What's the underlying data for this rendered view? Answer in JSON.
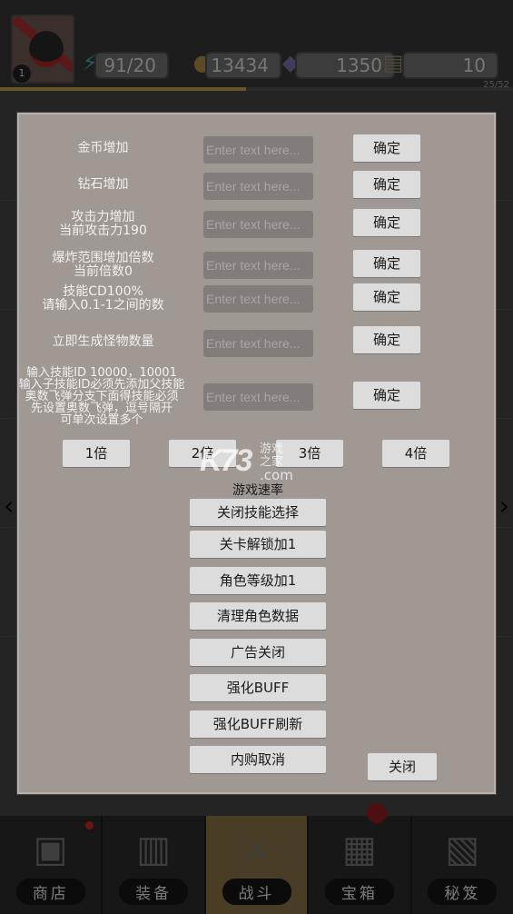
{
  "hud": {
    "player_level": "1",
    "energy": "91/20",
    "gold": "13434",
    "diamonds": "1350",
    "scrolls": "10",
    "stage_progress_label": "25/52",
    "stage_progress_fraction": 0.48,
    "icons": {
      "energy": "lightning-icon",
      "gold": "coin-icon",
      "diamonds": "diamond-icon",
      "scrolls": "scroll-icon"
    }
  },
  "dialog": {
    "input_placeholder": "Enter text here...",
    "confirm_label": "确定",
    "fields": [
      {
        "label_lines": [
          "金币增加"
        ]
      },
      {
        "label_lines": [
          "钻石增加"
        ]
      },
      {
        "label_lines": [
          "攻击力增加",
          "当前攻击力190"
        ]
      },
      {
        "label_lines": [
          "爆炸范围增加倍数",
          "当前倍数0"
        ]
      },
      {
        "label_lines": [
          "技能CD100%",
          "请输入0.1-1之间的数"
        ]
      },
      {
        "label_lines": [
          "立即生成怪物数量"
        ]
      },
      {
        "label_lines": [
          "输入技能ID 10000，10001",
          "输入子技能ID必须先添加父技能",
          "奥数飞弹分支下面得技能必须",
          "先设置奥数飞弹，逗号隔开",
          "可单次设置多个"
        ]
      }
    ],
    "speed_buttons": [
      "1倍",
      "2倍",
      "3倍",
      "4倍"
    ],
    "speed_title": "游戏速率",
    "action_buttons": [
      "关闭技能选择",
      "关卡解锁加1",
      "角色等级加1",
      "清理角色数据",
      "广告关闭",
      "强化BUFF",
      "强化BUFF刷新",
      "内购取消"
    ],
    "close_label": "关闭"
  },
  "watermark": {
    "logo": "K73",
    "line1": "游戏之家",
    "line2": ".com"
  },
  "bottom_nav": {
    "items": [
      {
        "label": "商店",
        "icon": "shop-icon",
        "badge": "dot"
      },
      {
        "label": "装备",
        "icon": "equipment-bag-icon"
      },
      {
        "label": "战斗",
        "icon": "battle-sword-icon",
        "active": true
      },
      {
        "label": "宝箱",
        "icon": "treasure-chest-icon",
        "badge": "bubble"
      },
      {
        "label": "秘笈",
        "icon": "secret-book-icon"
      }
    ]
  }
}
